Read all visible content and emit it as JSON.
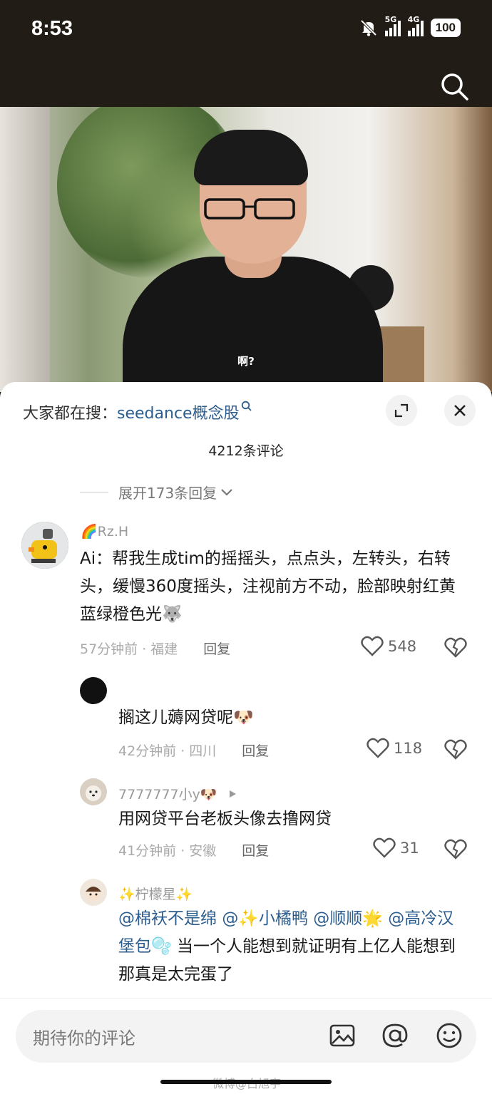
{
  "status_bar": {
    "time": "8:53",
    "network1": "5G",
    "network2": "4G",
    "battery": "100",
    "icons": [
      "bell-off-icon",
      "signal-icon",
      "signal-icon",
      "battery-icon"
    ]
  },
  "video": {
    "subtitle": "啊?"
  },
  "sheet": {
    "search_prefix": "大家都在搜：",
    "search_keyword": "seedance概念股",
    "comment_count": "4212条评论",
    "expand_replies": "展开173条回复"
  },
  "comments": [
    {
      "name": "🌈Rz.H",
      "text": "Ai：帮我生成tim的摇摇头，点点头，左转头，右转头，缓慢360度摇头，注视前方不动，脸部映射红黄蓝绿橙色光🐺",
      "time_location": "57分钟前 · 福建",
      "reply_label": "回复",
      "likes": "548"
    },
    {
      "name": "",
      "text": "搁这儿薅网贷呢🐶",
      "time_location": "42分钟前 · 四川",
      "reply_label": "回复",
      "likes": "118"
    },
    {
      "name": "7777777小y🐶",
      "text": "用网贷平台老板头像去撸网贷",
      "time_location": "41分钟前 · 安徽",
      "reply_label": "回复",
      "likes": "31"
    },
    {
      "name": "✨柠檬星✨",
      "mentions": [
        "@棉袄不是绵",
        "@✨小橘鸭",
        "@顺顺🌟",
        "@高冷汉堡包🫧"
      ],
      "text": "当一个人能想到就证明有上亿人能想到那真是太完蛋了"
    }
  ],
  "input_bar": {
    "placeholder": "期待你的评论",
    "watermark": "微博@白旭宇",
    "icons": [
      "image-icon",
      "at-icon",
      "emoji-icon"
    ]
  }
}
